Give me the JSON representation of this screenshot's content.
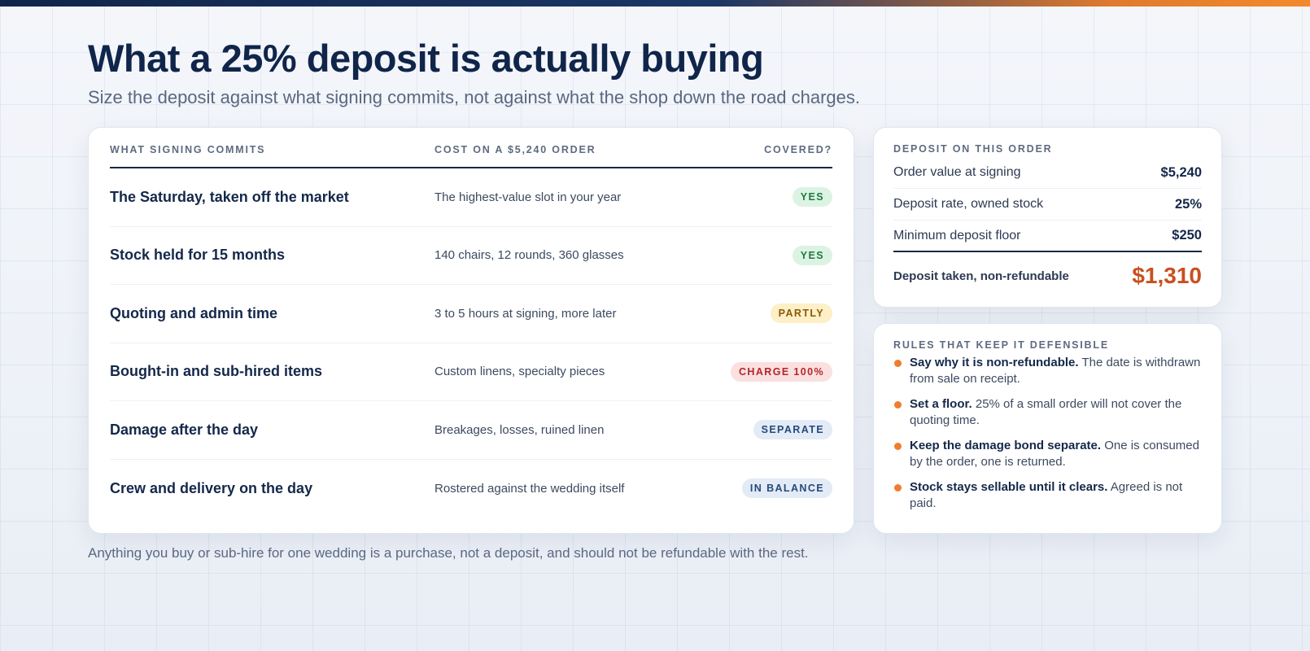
{
  "page": {
    "title": "What a 25% deposit is actually buying",
    "subtitle": "Size the deposit against what signing commits, not against what the shop down the road charges.",
    "footnote": "Anything you buy or sub-hire for one wedding is a purchase, not a deposit, and should not be refundable with the rest."
  },
  "colors": {
    "accent": "#ef7d2c",
    "navy": "#14284a",
    "total": "#c8501e"
  },
  "table": {
    "headers": [
      "WHAT SIGNING COMMITS",
      "COST ON A $5,240 ORDER",
      "COVERED?"
    ],
    "rows": [
      {
        "name": "The Saturday, taken off the market",
        "cost": "The highest-value slot in your year",
        "status": "YES",
        "status_color": "#1f7a3f",
        "status_bg": "#dcf3e3"
      },
      {
        "name": "Stock held for 15 months",
        "cost": "140 chairs, 12 rounds, 360 glasses",
        "status": "YES",
        "status_color": "#1f7a3f",
        "status_bg": "#dcf3e3"
      },
      {
        "name": "Quoting and admin time",
        "cost": "3 to 5 hours at signing, more later",
        "status": "PARTLY",
        "status_color": "#8a5a06",
        "status_bg": "#fdefc6"
      },
      {
        "name": "Bought-in and sub-hired items",
        "cost": "Custom linens, specialty pieces",
        "status": "CHARGE 100%",
        "status_color": "#b3262e",
        "status_bg": "#fbe0e0"
      },
      {
        "name": "Damage after the day",
        "cost": "Breakages, losses, ruined linen",
        "status": "SEPARATE",
        "status_color": "#254a7a",
        "status_bg": "#e3ebf6"
      },
      {
        "name": "Crew and delivery on the day",
        "cost": "Rostered against the wedding itself",
        "status": "IN BALANCE",
        "status_color": "#254a7a",
        "status_bg": "#e3ebf6"
      }
    ]
  },
  "deposit": {
    "label": "DEPOSIT ON THIS ORDER",
    "rows": [
      {
        "label": "Order value at signing",
        "value": "$5,240"
      },
      {
        "label": "Deposit rate, owned stock",
        "value": "25%"
      },
      {
        "label": "Minimum deposit floor",
        "value": "$250"
      }
    ],
    "total_label": "Deposit taken, non-refundable",
    "total_value": "$1,310"
  },
  "rules": {
    "label": "RULES THAT KEEP IT DEFENSIBLE",
    "items": [
      {
        "bold": "Say why it is non-refundable.",
        "text": " The date is withdrawn from sale on receipt."
      },
      {
        "bold": "Set a floor.",
        "text": " 25% of a small order will not cover the quoting time."
      },
      {
        "bold": "Keep the damage bond separate.",
        "text": " One is consumed by the order, one is returned."
      },
      {
        "bold": "Stock stays sellable until it clears.",
        "text": " Agreed is not paid."
      }
    ]
  }
}
